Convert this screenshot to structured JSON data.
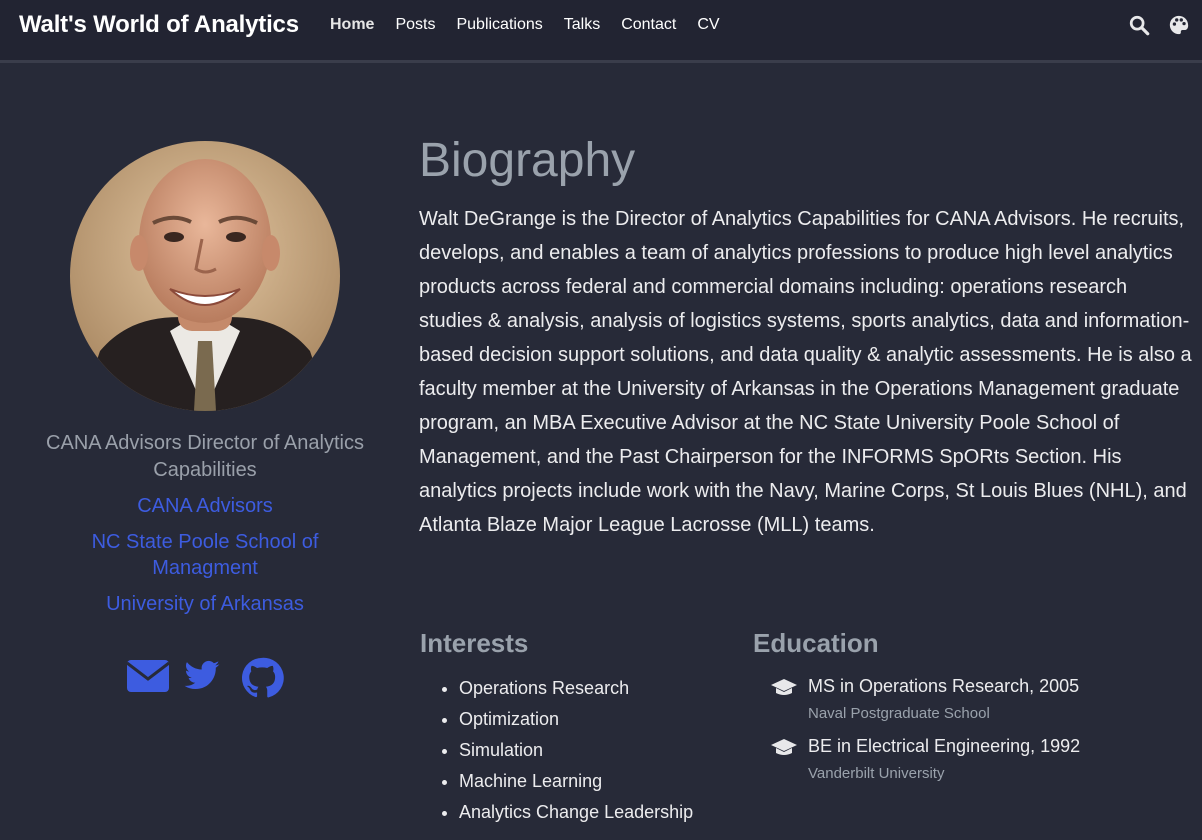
{
  "navbar": {
    "brand": "Walt's World of Analytics",
    "links": [
      "Home",
      "Posts",
      "Publications",
      "Talks",
      "Contact",
      "CV"
    ],
    "active": "Home",
    "icons": [
      "search-icon",
      "palette-icon"
    ]
  },
  "profile": {
    "role": "CANA Advisors Director of Analytics Capabilities",
    "organizations": [
      "CANA Advisors",
      "NC State Poole School of Managment",
      "University of Arkansas"
    ],
    "social_icons": [
      "envelope-icon",
      "twitter-icon",
      "github-icon"
    ],
    "accent_color": "#3d5ce0"
  },
  "biography": {
    "title": "Biography",
    "text": "Walt DeGrange is the Director of Analytics Capabilities for CANA Advisors. He recruits, develops, and enables a team of analytics professions to produce high level analytics products across federal and commercial domains including: operations research studies & analysis, analysis of logistics systems, sports analytics, data and information-based decision support solutions, and data quality & analytic assessments. He is also a faculty member at the University of Arkansas in the Operations Management graduate program, an MBA Executive Advisor at the NC State University Poole School of Management, and the Past Chairperson for the INFORMS SpORts Section. His analytics projects include work with the Navy, Marine Corps, St Louis Blues (NHL), and Atlanta Blaze Major League Lacrosse (MLL) teams."
  },
  "interests": {
    "title": "Interests",
    "items": [
      "Operations Research",
      "Optimization",
      "Simulation",
      "Machine Learning",
      "Analytics Change Leadership"
    ]
  },
  "education": {
    "title": "Education",
    "items": [
      {
        "course": "MS in Operations Research, 2005",
        "institution": "Naval Postgraduate School"
      },
      {
        "course": "BE in Electrical Engineering, 1992",
        "institution": "Vanderbilt University"
      }
    ]
  }
}
